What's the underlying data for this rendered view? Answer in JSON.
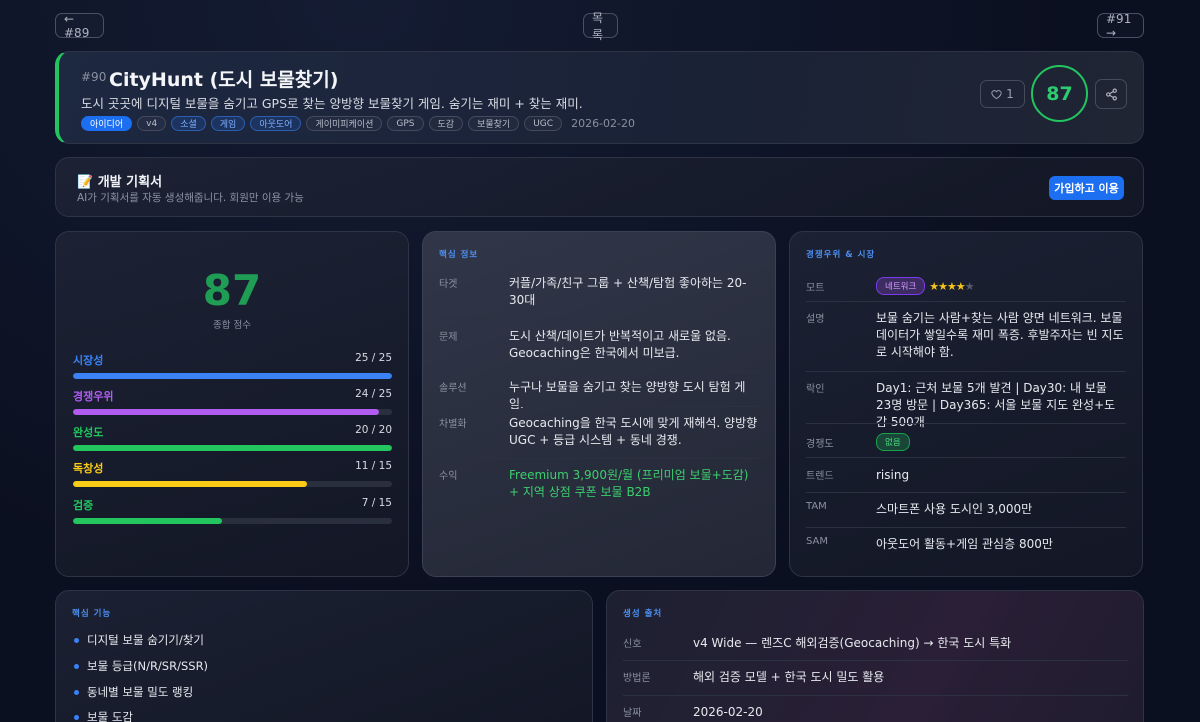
{
  "nav": {
    "prev": "← #89",
    "list": "목록",
    "next": "#91 →"
  },
  "header": {
    "number": "#90",
    "title": "CityHunt (도시 보물찾기)",
    "description": "도시 곳곳에 디지털 보물을 숨기고 GPS로 찾는 양방향 보물찾기 게임. 숨기는 재미 + 찾는 재미.",
    "tags": [
      "아이디어",
      "v4",
      "소셜",
      "게임",
      "아웃도어",
      "게이미피케이션",
      "GPS",
      "도감",
      "보물찾기",
      "UGC"
    ],
    "date": "2026-02-20",
    "likes": "1",
    "score": "87"
  },
  "plan": {
    "title": "📝 개발 기획서",
    "subtitle": "AI가 기획서를 자동 생성해줍니다. 회원만 이용 가능",
    "button": "가입하고 이용"
  },
  "score_card": {
    "total": "87",
    "total_label": "종합 점수",
    "metrics": [
      {
        "label": "시장성",
        "value": "25 / 25",
        "score": 25,
        "max": 25,
        "color": "#3b82f6"
      },
      {
        "label": "경쟁우위",
        "value": "24 / 25",
        "score": 24,
        "max": 25,
        "color": "#b05cf0"
      },
      {
        "label": "완성도",
        "value": "20 / 20",
        "score": 20,
        "max": 20,
        "color": "#22c55e"
      },
      {
        "label": "독창성",
        "value": "11 / 15",
        "score": 11,
        "max": 15,
        "color": "#facc15"
      },
      {
        "label": "검증",
        "value": "7 / 15",
        "score": 7,
        "max": 15,
        "color": "#22c55e"
      }
    ]
  },
  "core": {
    "title": "핵심 정보",
    "rows": [
      {
        "k": "타겟",
        "v": "커플/가족/친구 그룹 + 산책/탐험 좋아하는 20-30대"
      },
      {
        "k": "문제",
        "v": "도시 산책/데이트가 반복적이고 새로울 없음. Geocaching은 한국에서 미보급."
      },
      {
        "k": "솔루션",
        "v": "누구나 보물을 숨기고 찾는 양방향 도시 탐험 게임."
      },
      {
        "k": "차별화",
        "v": "Geocaching을 한국 도시에 맞게 재해석. 양방향 UGC + 등급 시스템 + 동네 경쟁."
      },
      {
        "k": "수익",
        "v": "Freemium 3,900원/월 (프리미엄 보물+도감) + 지역 상점 쿠폰 보물 B2B"
      }
    ]
  },
  "comp": {
    "title": "경쟁우위 & 시장",
    "moat_label": "모트",
    "moat_badge": "네트워크",
    "moat_stars": 4,
    "moat_stars_max": 5,
    "desc_label": "설명",
    "desc": "보물 숨기는 사람+찾는 사람 양면 네트워크. 보물 데이터가 쌓일수록 재미 폭증. 후발주자는 빈 지도로 시작해야 함.",
    "lockin_label": "락인",
    "lockin": "Day1: 근처 보물 5개 발견 | Day30: 내 보물 23명 방문 | Day365: 서울 보물 지도 완성+도감 500개",
    "competition_label": "경쟁도",
    "competition_badge": "없음",
    "trend_label": "트렌드",
    "trend": "rising",
    "tam_label": "TAM",
    "tam": "스마트폰 사용 도시인 3,000만",
    "sam_label": "SAM",
    "sam": "아웃도어 활동+게임 관심층 800만"
  },
  "features": {
    "title": "핵심 기능",
    "items": [
      "디지털 보물 숨기기/찾기",
      "보물 등급(N/R/SR/SSR)",
      "동네별 보물 밀도 랭킹",
      "보물 도감"
    ]
  },
  "origin": {
    "title": "생성 출처",
    "rows": [
      {
        "k": "신호",
        "v": "v4 Wide — 렌즈C 해외검증(Geocaching) → 한국 도시 특화"
      },
      {
        "k": "방법론",
        "v": "해외 검증 모델 + 한국 도시 밀도 활용"
      },
      {
        "k": "날짜",
        "v": "2026-02-20"
      }
    ]
  },
  "colors": {
    "accent": "#1d6ff2",
    "score_green": "#22c55e",
    "section_blue": "#4d8ff0"
  }
}
